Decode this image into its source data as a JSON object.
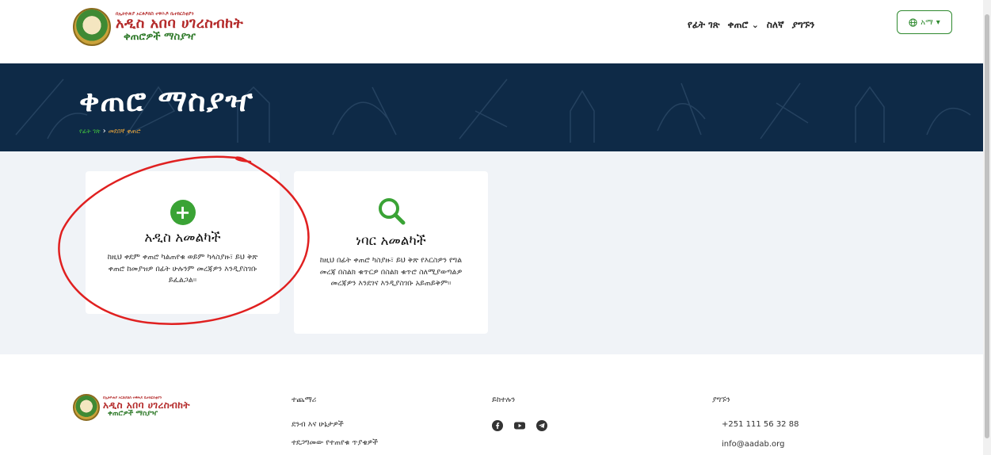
{
  "header": {
    "logo": {
      "subtitle": "በኢትዮጵያ ኦርቶዶክስ ተዋሕዶ ቤተክርስቲያን",
      "title": "አዲስ አበባ ሀገረስብከት",
      "tagline": "ቀጠሮዎች ማስያዣ"
    },
    "nav": {
      "home": "የፊት ገጽ",
      "appointment": "ቀጠሮ",
      "about": "ስለኛ",
      "contact": "ያግኙን"
    },
    "language_label": "አማ",
    "globe_icon": "globe-icon"
  },
  "banner": {
    "title": "ቀጠሮ ማስያዣ",
    "breadcrumb": {
      "home": "የፊት ገጽ",
      "separator": "›",
      "current": "መደበኛ ቀጠሮ"
    },
    "background_color": "#0e2a47"
  },
  "cards": [
    {
      "title": "አዲስ አመልካች",
      "description": "ከዚህ ቀደም ቀጠሮ ካልጠየቁ ወይም ካላስያዙ፣ ይህ ቅጽ ቀጠሮ ከመያዝዎ በፊት ሁሉንም መረጃዎን እንዲያስገቡ ይፈልጋል።",
      "icon": "plus-circle-icon"
    },
    {
      "title": "ነባር አመልካች",
      "description": "ከዚህ በፊት ቀጠሮ ካስያዙ፣ ይህ ቅጽ የእርስዎን የግል መረጃ በስልክ ቁጥርዎ በስልክ ቁጥሮ ስለሚያወጣልዎ መረጃዎን እንደገና እንዲያስገቡ አይጠይቅም።",
      "icon": "search-icon"
    }
  ],
  "footer": {
    "logo": {
      "subtitle": "በኢትዮጵያ ኦርቶዶክስ ተዋሕዶ ቤተክርስቲያን",
      "title": "አዲስ አበባ ሀገረስብከት",
      "tagline": "ቀጠሮዎች ማስያዣ"
    },
    "more": {
      "heading": "ተጨማሪ",
      "links": [
        "ደንብ እና ሁኔታዎች",
        "ተደጋግመው የተጠየቁ ጥያቄዎች"
      ]
    },
    "follow": {
      "heading": "ይከተሉን",
      "icons": [
        "facebook-icon",
        "youtube-icon",
        "telegram-icon"
      ]
    },
    "contact": {
      "heading": "ያግኙን",
      "phone": "+251 111 56 32 88",
      "email": "info@aadab.org"
    }
  },
  "colors": {
    "accent_green": "#3aa335",
    "brand_red": "#b42a2a",
    "banner_navy": "#0e2a47",
    "breadcrumb_orange": "#e8a43a",
    "annotation_red": "#e02020"
  }
}
